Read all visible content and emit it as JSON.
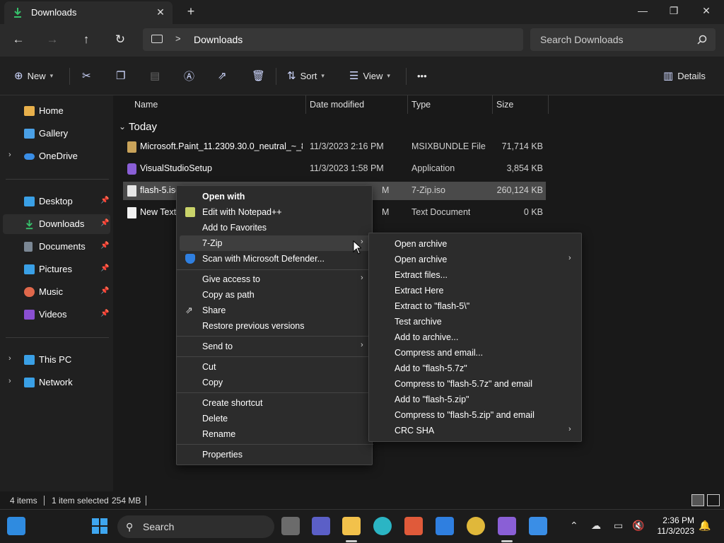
{
  "window": {
    "tab_title": "Downloads",
    "tab_close": "✕",
    "new_tab": "+",
    "minimize": "—",
    "maximize": "❐",
    "close": "✕"
  },
  "address": {
    "back": "←",
    "forward": "→",
    "up": "↑",
    "refresh": "↻",
    "chevron": ">",
    "path": "Downloads",
    "search_placeholder": "Search Downloads"
  },
  "toolbar": {
    "new_label": "New",
    "sort_label": "Sort",
    "view_label": "View",
    "more": "•••",
    "details_label": "Details"
  },
  "sidebar": {
    "items": [
      {
        "label": "Home",
        "icon": "home-icon",
        "color": "#e8b04b"
      },
      {
        "label": "Gallery",
        "icon": "gallery-icon",
        "color": "#4aa0e6"
      },
      {
        "label": "OneDrive",
        "icon": "cloud-icon",
        "color": "#3a8ee6"
      },
      {
        "label": "Desktop",
        "icon": "desktop-icon",
        "color": "#3aa0e6"
      },
      {
        "label": "Downloads",
        "icon": "download-icon",
        "color": "#37c06b"
      },
      {
        "label": "Documents",
        "icon": "document-icon",
        "color": "#7b8794"
      },
      {
        "label": "Pictures",
        "icon": "pictures-icon",
        "color": "#3aa0e6"
      },
      {
        "label": "Music",
        "icon": "music-icon",
        "color": "#e0684b"
      },
      {
        "label": "Videos",
        "icon": "video-icon",
        "color": "#8a4fd1"
      },
      {
        "label": "This PC",
        "icon": "pc-icon",
        "color": "#3aa0e6"
      },
      {
        "label": "Network",
        "icon": "network-icon",
        "color": "#3aa0e6"
      }
    ]
  },
  "columns": {
    "name": "Name",
    "date": "Date modified",
    "type": "Type",
    "size": "Size"
  },
  "group": {
    "label": "Today"
  },
  "files": [
    {
      "name": "Microsoft.Paint_11.2309.30.0_neutral_~_8...",
      "date": "11/3/2023 2:16 PM",
      "type": "MSIXBUNDLE File",
      "size": "71,714 KB"
    },
    {
      "name": "VisualStudioSetup",
      "date": "11/3/2023 1:58 PM",
      "type": "Application",
      "size": "3,854 KB"
    },
    {
      "name": "flash-5.iso",
      "date": "M",
      "type": "7-Zip.iso",
      "size": "260,124 KB"
    },
    {
      "name": "New Text",
      "date": "M",
      "type": "Text Document",
      "size": "0 KB"
    }
  ],
  "context_menu": {
    "open_with": "Open with",
    "edit_notepad": "Edit with Notepad++",
    "add_favorites": "Add to Favorites",
    "seven_zip": "7-Zip",
    "scan_defender": "Scan with Microsoft Defender...",
    "give_access": "Give access to",
    "copy_path": "Copy as path",
    "share": "Share",
    "restore": "Restore previous versions",
    "send_to": "Send to",
    "cut": "Cut",
    "copy": "Copy",
    "create_shortcut": "Create shortcut",
    "delete": "Delete",
    "rename": "Rename",
    "properties": "Properties"
  },
  "submenu": {
    "items": [
      {
        "label": "Open archive",
        "arrow": ""
      },
      {
        "label": "Open archive",
        "arrow": "›"
      },
      {
        "label": "Extract files...",
        "arrow": ""
      },
      {
        "label": "Extract Here",
        "arrow": ""
      },
      {
        "label": "Extract to \"flash-5\\\"",
        "arrow": ""
      },
      {
        "label": "Test archive",
        "arrow": ""
      },
      {
        "label": "Add to archive...",
        "arrow": ""
      },
      {
        "label": "Compress and email...",
        "arrow": ""
      },
      {
        "label": "Add to \"flash-5.7z\"",
        "arrow": ""
      },
      {
        "label": "Compress to \"flash-5.7z\" and email",
        "arrow": ""
      },
      {
        "label": "Add to \"flash-5.zip\"",
        "arrow": ""
      },
      {
        "label": "Compress to \"flash-5.zip\" and email",
        "arrow": ""
      },
      {
        "label": "CRC SHA",
        "arrow": "›"
      }
    ]
  },
  "status": {
    "items": "4 items",
    "selected": "1 item selected",
    "size": "254 MB"
  },
  "taskbar": {
    "search": "Search",
    "time": "2:36 PM",
    "date": "11/3/2023"
  }
}
